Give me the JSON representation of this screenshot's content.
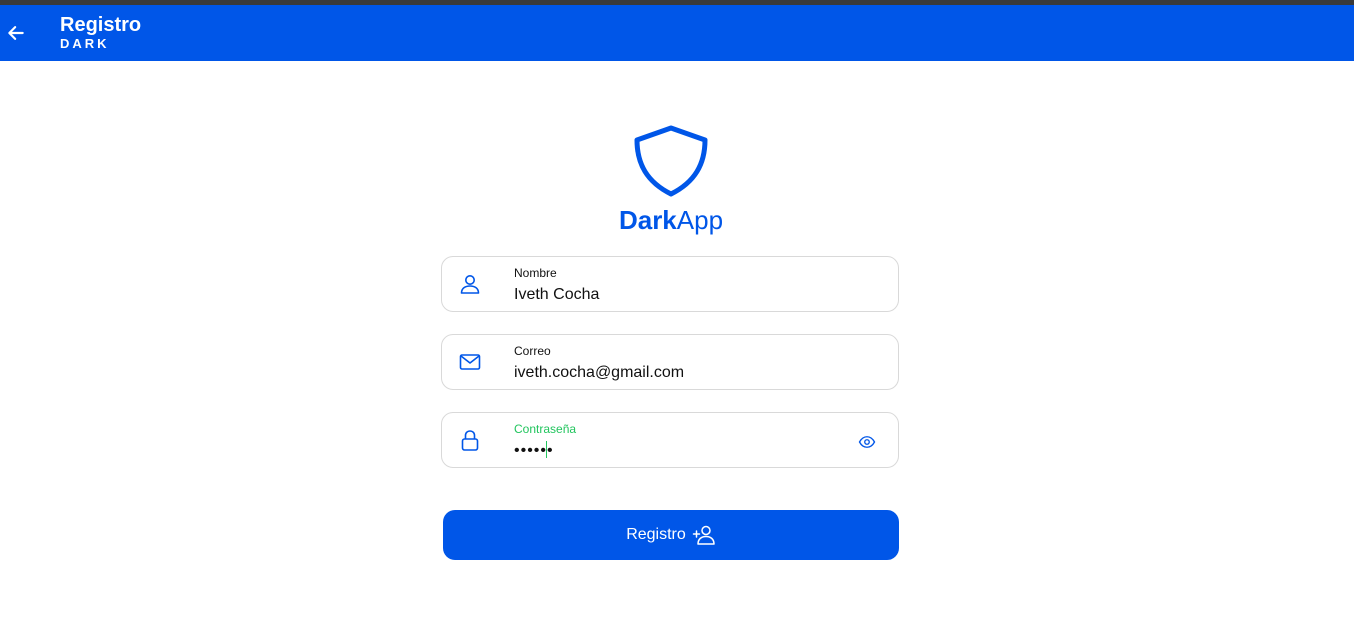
{
  "appbar": {
    "title": "Registro",
    "subtitle": "DARK",
    "back_icon": "arrow-left-icon",
    "color": "#0056e8"
  },
  "brand": {
    "logo_icon": "shield-icon",
    "name_bold": "Dark",
    "name_regular": "App"
  },
  "form": {
    "name": {
      "label": "Nombre",
      "value": "Iveth Cocha",
      "icon": "user-icon"
    },
    "email": {
      "label": "Correo",
      "value": "iveth.cocha@gmail.com",
      "icon": "envelope-icon"
    },
    "password": {
      "label": "Contraseña",
      "value": "••••••",
      "icon": "lock-icon",
      "toggle_icon": "eye-icon",
      "label_color": "#22c55e"
    },
    "submit": {
      "label": "Registro",
      "icon": "user-plus-icon"
    }
  }
}
